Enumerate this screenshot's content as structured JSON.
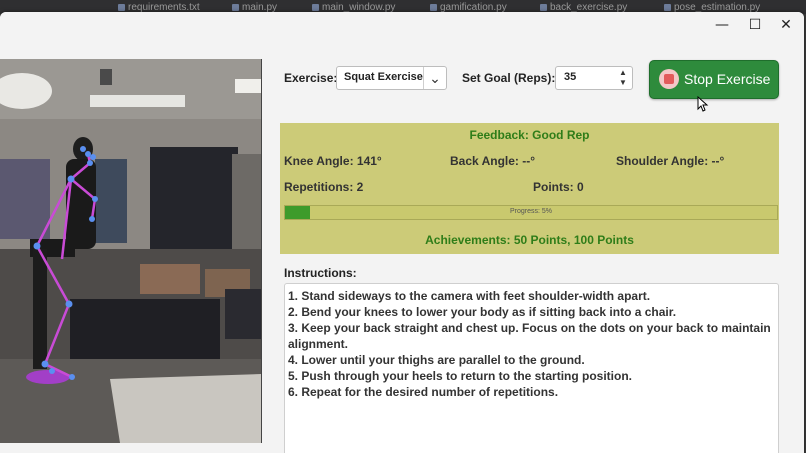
{
  "editor_tabs": [
    "requirements.txt",
    "main.py",
    "main_window.py",
    "gamification.py",
    "back_exercise.py",
    "pose_estimation.py"
  ],
  "window": {
    "minimize": "—",
    "maximize": "☐",
    "close": "✕"
  },
  "controls": {
    "exercise_label": "Exercise:",
    "exercise_value": "Squat Exercise",
    "goal_label": "Set Goal (Reps):",
    "goal_value": "35",
    "stop_button": "Stop Exercise"
  },
  "feedback": {
    "title": "Feedback: Good Rep",
    "knee_angle": "Knee Angle: 141°",
    "back_angle": "Back Angle: --°",
    "shoulder_angle": "Shoulder Angle: --°",
    "repetitions": "Repetitions: 2",
    "points": "Points: 0",
    "progress_text": "Progress: 5%",
    "progress_value": 0.05,
    "achievements": "Achievements: 50 Points, 100 Points"
  },
  "instructions": {
    "label": "Instructions:",
    "lines": [
      "1. Stand sideways to the camera with feet shoulder-width apart.",
      "2. Bend your knees to lower your body as if sitting back into a chair.",
      "3. Keep your back straight and chest up. Focus on the dots on your back to maintain",
      "alignment.",
      "4. Lower until your thighs are parallel to the ground.",
      "5. Push through your heels to return to the starting position.",
      "6. Repeat for the desired number of repetitions."
    ]
  },
  "colors": {
    "stop_button": "#2e8b3c",
    "feedback_bg": "#cccb78",
    "feedback_text": "#2f7d19",
    "progress_fill": "#3e9b2b",
    "skeleton": "#c94bd6",
    "landmark": "#5a8ff0"
  }
}
